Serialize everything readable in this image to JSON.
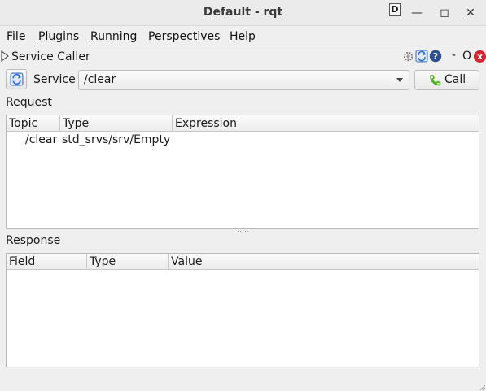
{
  "window": {
    "title": "Default - rqt"
  },
  "menu": {
    "file": {
      "u": "F",
      "rest": "ile"
    },
    "plugins": {
      "u": "P",
      "rest": "lugins"
    },
    "running": {
      "u": "R",
      "rest": "unning"
    },
    "perspectives": {
      "pre": "P",
      "u": "e",
      "rest": "rspectives"
    },
    "help": {
      "u": "H",
      "rest": "elp"
    }
  },
  "plugin": {
    "title": "Service Caller",
    "d_label": "D",
    "dash": "-",
    "o_label": "O",
    "close_label": "x"
  },
  "service": {
    "label": "Service",
    "value": "/clear",
    "call_label": "Call"
  },
  "request": {
    "label": "Request",
    "columns": [
      "Topic",
      "Type",
      "Expression"
    ],
    "rows": [
      {
        "topic": "/clear",
        "type": "std_srvs/srv/Empty",
        "expression": ""
      }
    ]
  },
  "response": {
    "label": "Response",
    "columns": [
      "Field",
      "Type",
      "Value"
    ]
  },
  "icons": {
    "refresh": "refresh-icon",
    "phone": "phone-icon",
    "help": "help-icon",
    "gear": "gear-icon"
  },
  "colors": {
    "close_red": "#d9232e",
    "phone_green": "#4caf1a",
    "refresh_blue": "#2f6fcf"
  }
}
